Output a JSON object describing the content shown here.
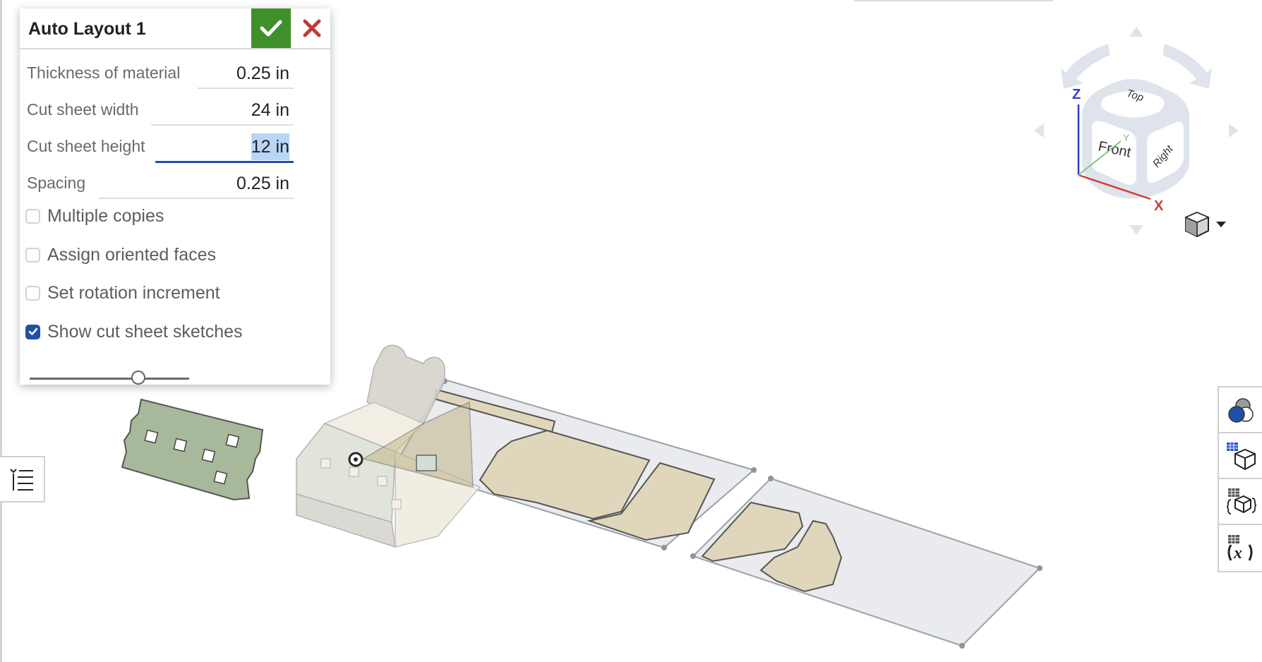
{
  "dialog": {
    "title": "Auto Layout 1",
    "ok_icon": "checkmark-icon",
    "cancel_icon": "close-icon",
    "fields": [
      {
        "label": "Thickness of material",
        "value": "0.25 in",
        "active": false
      },
      {
        "label": "Cut sheet width",
        "value": "24 in",
        "active": false
      },
      {
        "label": "Cut sheet height",
        "value": "12 in",
        "active": true,
        "selected_text": "12 in"
      },
      {
        "label": "Spacing",
        "value": "0.25 in",
        "active": false
      }
    ],
    "checkboxes": [
      {
        "label": "Multiple copies",
        "checked": false
      },
      {
        "label": "Assign oriented faces",
        "checked": false
      },
      {
        "label": "Set rotation increment",
        "checked": false
      },
      {
        "label": "Show cut sheet sketches",
        "checked": true
      }
    ],
    "slider": {
      "value": 0.7
    }
  },
  "viewcube": {
    "faces": {
      "top": "Top",
      "front": "Front",
      "right": "Right"
    },
    "axes": {
      "x": "X",
      "y": "Y",
      "z": "Z"
    },
    "colors": {
      "x": "#d23b3b",
      "y": "#7cc47c",
      "z": "#2a3fc8"
    },
    "view_mode_icon": "shaded-cube-icon"
  },
  "left_panel": {
    "icon": "feature-list-icon"
  },
  "right_toolbar": [
    {
      "icon": "appearance-icon"
    },
    {
      "icon": "configuration-table-icon"
    },
    {
      "icon": "variable-studio-icon"
    },
    {
      "icon": "variable-table-icon"
    }
  ],
  "colors": {
    "accent": "#2150a8",
    "ok_green": "#3f8f2a",
    "cancel_red": "#c0393b",
    "part_tan": "#e0d6bc",
    "part_green": "#a7b99a",
    "sheet_fill": "#e9ebef"
  }
}
